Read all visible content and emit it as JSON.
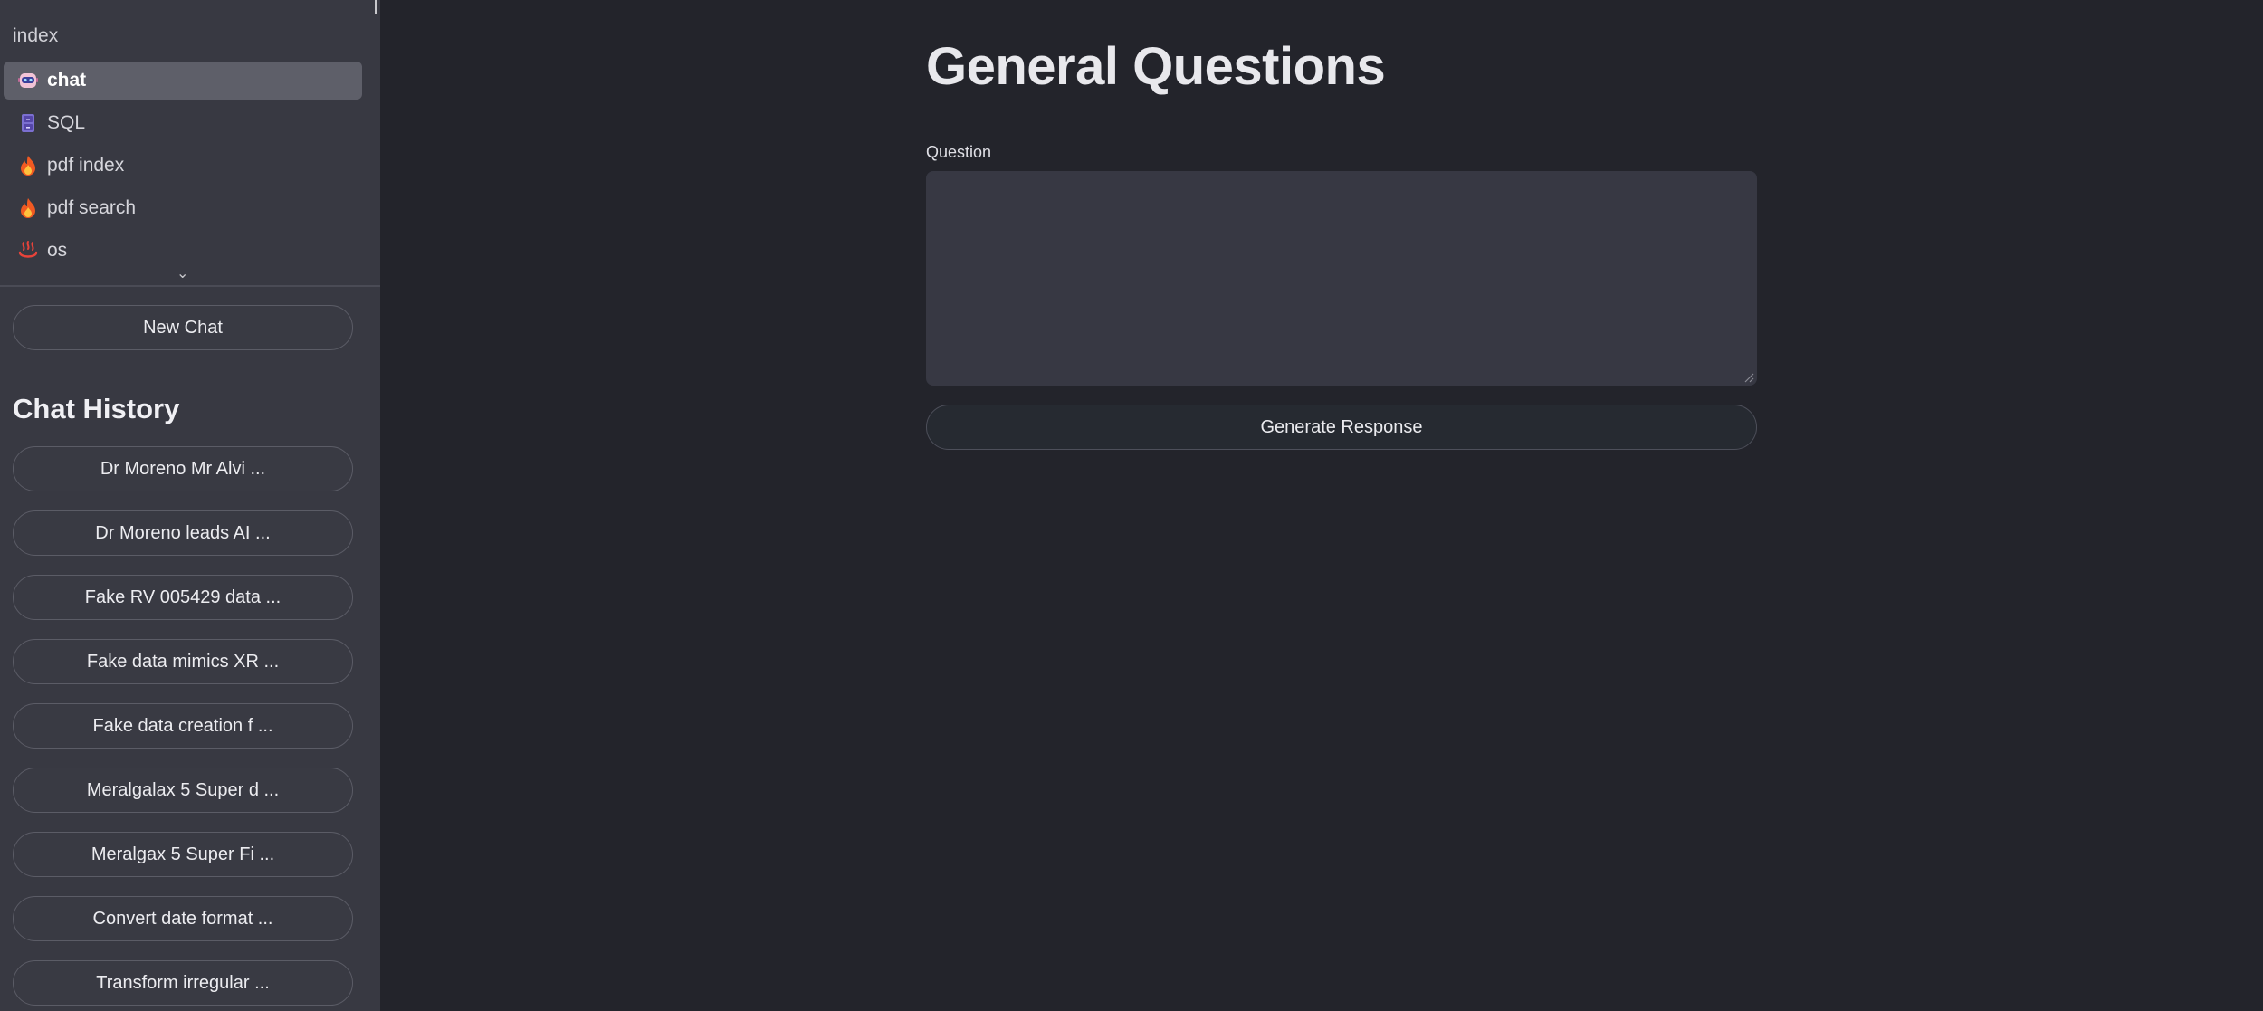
{
  "sidebar": {
    "nav_header": "index",
    "nav_items": [
      {
        "label": "chat",
        "icon": "robot-icon",
        "active": true
      },
      {
        "label": "SQL",
        "icon": "file-cabinet-icon",
        "active": false
      },
      {
        "label": "pdf index",
        "icon": "fire-icon",
        "active": false
      },
      {
        "label": "pdf search",
        "icon": "fire-icon",
        "active": false
      },
      {
        "label": "os",
        "icon": "hot-springs-icon",
        "active": false
      }
    ],
    "new_chat_label": "New Chat",
    "history_title": "Chat History",
    "history": [
      "Dr Moreno Mr Alvi ...",
      "Dr Moreno leads AI ...",
      "Fake RV 005429 data ...",
      "Fake data mimics XR ...",
      "Fake data creation f ...",
      "Meralgalax 5 Super d ...",
      "Meralgax 5 Super Fi ...",
      "Convert date format ...",
      "Transform irregular ..."
    ]
  },
  "main": {
    "title": "General Questions",
    "question_label": "Question",
    "question_value": "",
    "generate_label": "Generate Response"
  },
  "colors": {
    "background": "#23242b",
    "sidebar": "#383942",
    "active_item": "#5e5f69"
  }
}
